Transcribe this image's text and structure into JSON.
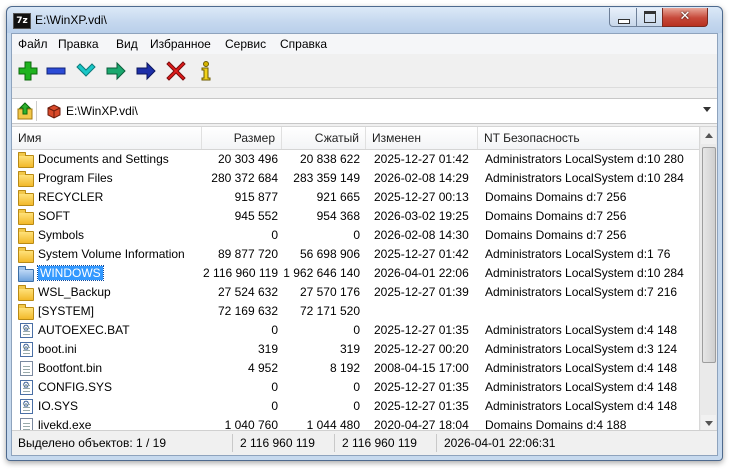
{
  "window": {
    "title": "E:\\WinXP.vdi\\",
    "app_icon_text": "7z"
  },
  "menu": [
    "Файл",
    "Правка",
    "Вид",
    "Избранное",
    "Сервис",
    "Справка"
  ],
  "toolbar": [
    "add-icon",
    "remove-icon",
    "test-icon",
    "copy-icon",
    "move-icon",
    "delete-icon",
    "info-icon"
  ],
  "address": {
    "path": "E:\\WinXP.vdi\\"
  },
  "columns": {
    "name": "Имя",
    "size": "Размер",
    "packed": "Сжатый",
    "modified": "Изменен",
    "security": "NT Безопасность"
  },
  "rows": [
    {
      "name": "Documents and Settings",
      "size": "20 303 496",
      "packed": "20 838 622",
      "modified": "2025-12-27 01:42",
      "security": "Administrators LocalSystem d:10 280",
      "type": "folder"
    },
    {
      "name": "Program Files",
      "size": "280 372 684",
      "packed": "283 359 149",
      "modified": "2026-02-08 14:29",
      "security": "Administrators LocalSystem d:10 284",
      "type": "folder"
    },
    {
      "name": "RECYCLER",
      "size": "915 877",
      "packed": "921 665",
      "modified": "2025-12-27 00:13",
      "security": "Domains Domains d:7 256",
      "type": "folder"
    },
    {
      "name": "SOFT",
      "size": "945 552",
      "packed": "954 368",
      "modified": "2026-03-02 19:25",
      "security": "Domains Domains d:7 256",
      "type": "folder"
    },
    {
      "name": "Symbols",
      "size": "0",
      "packed": "0",
      "modified": "2026-02-08 14:30",
      "security": "Domains Domains d:7 256",
      "type": "folder"
    },
    {
      "name": "System Volume Information",
      "size": "89 877 720",
      "packed": "56 698 906",
      "modified": "2025-12-27 01:42",
      "security": "Administrators LocalSystem d:1 76",
      "type": "folder"
    },
    {
      "name": "WINDOWS",
      "size": "2 116 960 119",
      "packed": "1 962 646 140",
      "modified": "2026-04-01 22:06",
      "security": "Administrators LocalSystem d:10 284",
      "type": "folder-selected"
    },
    {
      "name": "WSL_Backup",
      "size": "27 524 632",
      "packed": "27 570 176",
      "modified": "2025-12-27 01:39",
      "security": "Administrators LocalSystem d:7 216",
      "type": "folder"
    },
    {
      "name": "[SYSTEM]",
      "size": "72 169 632",
      "packed": "72 171 520",
      "modified": "",
      "security": "",
      "type": "folder"
    },
    {
      "name": "AUTOEXEC.BAT",
      "size": "0",
      "packed": "0",
      "modified": "2025-12-27 01:35",
      "security": "Administrators LocalSystem d:4 148",
      "type": "cfg"
    },
    {
      "name": "boot.ini",
      "size": "319",
      "packed": "319",
      "modified": "2025-12-27 00:20",
      "security": "Administrators LocalSystem d:3 124",
      "type": "cfg"
    },
    {
      "name": "Bootfont.bin",
      "size": "4 952",
      "packed": "8 192",
      "modified": "2008-04-15 17:00",
      "security": "Administrators LocalSystem d:4 148",
      "type": "file"
    },
    {
      "name": "CONFIG.SYS",
      "size": "0",
      "packed": "0",
      "modified": "2025-12-27 01:35",
      "security": "Administrators LocalSystem d:4 148",
      "type": "cfg"
    },
    {
      "name": "IO.SYS",
      "size": "0",
      "packed": "0",
      "modified": "2025-12-27 01:35",
      "security": "Administrators LocalSystem d:4 148",
      "type": "cfg"
    },
    {
      "name": "livekd.exe",
      "size": "1 040 760",
      "packed": "1 044 480",
      "modified": "2020-04-27 18:04",
      "security": "Domains Domains d:4 188",
      "type": "file"
    }
  ],
  "status": {
    "selected": "Выделено объектов: 1 / 19",
    "size": "2 116 960 119",
    "packed": "2 116 960 119",
    "modified": "2026-04-01 22:06:31"
  }
}
